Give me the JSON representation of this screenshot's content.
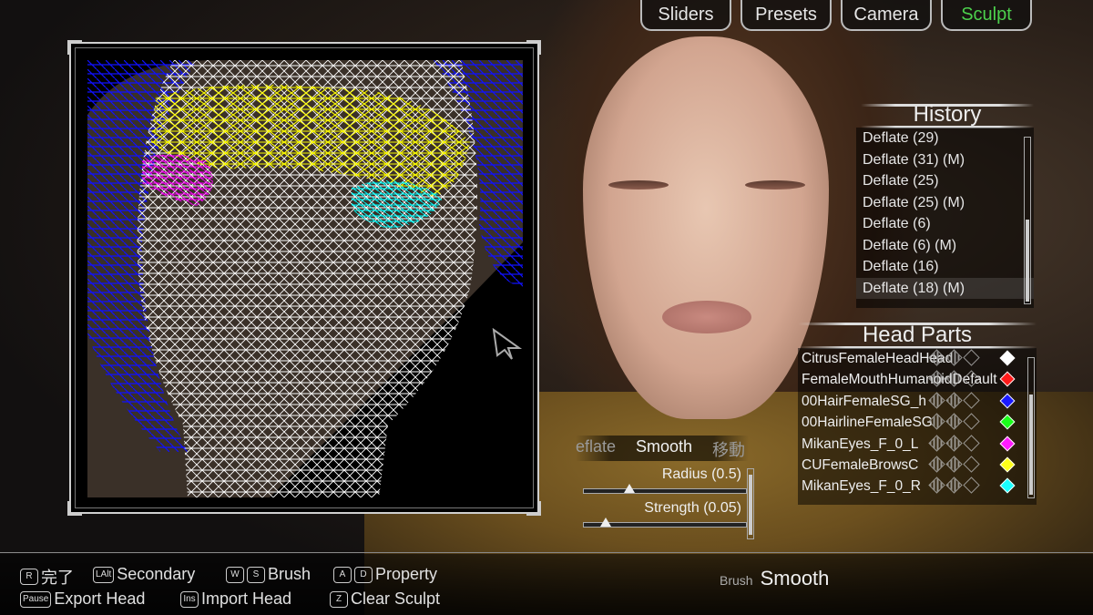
{
  "tabs": [
    {
      "label": "Sliders",
      "active": false
    },
    {
      "label": "Presets",
      "active": false
    },
    {
      "label": "Camera",
      "active": false
    },
    {
      "label": "Sculpt",
      "active": true
    }
  ],
  "history": {
    "title": "History",
    "items": [
      "Deflate (29)",
      "Deflate (31) (M)",
      "Deflate (25)",
      "Deflate (25) (M)",
      "Deflate (6)",
      "Deflate (6) (M)",
      "Deflate (16)",
      "Deflate (18) (M)"
    ],
    "selected_index": 7
  },
  "head_parts": {
    "title": "Head Parts",
    "items": [
      {
        "name": "CitrusFemaleHeadHead",
        "color": "#ffffff"
      },
      {
        "name": "FemaleMouthHumanoidDefault",
        "color": "#ff1a1a"
      },
      {
        "name": "00HairFemaleSG_h",
        "color": "#1a1aff"
      },
      {
        "name": "00HairlineFemaleSG",
        "color": "#1aff1a"
      },
      {
        "name": "MikanEyes_F_0_L",
        "color": "#ff1aff"
      },
      {
        "name": "CUFemaleBrowsC",
        "color": "#ffff1a"
      },
      {
        "name": "MikanEyes_F_0_R",
        "color": "#1affff"
      }
    ]
  },
  "brush_tabs": [
    {
      "label": "eflate",
      "active": false
    },
    {
      "label": "Smooth",
      "active": true
    },
    {
      "label": "移動",
      "active": false
    }
  ],
  "sliders": [
    {
      "label": "Radius (0.5)",
      "value": 0.5
    },
    {
      "label": "Strength (0.05)",
      "value": 0.05
    }
  ],
  "hints": [
    {
      "keys": [
        "R"
      ],
      "label": "完了"
    },
    {
      "keys": [
        "LAlt"
      ],
      "label": "Secondary"
    },
    {
      "keys": [
        "W",
        "S"
      ],
      "label": "Brush"
    },
    {
      "keys": [
        "A",
        "D"
      ],
      "label": "Property"
    },
    {
      "keys": [
        "Pause"
      ],
      "label": "Export Head"
    },
    {
      "keys": [
        "Ins"
      ],
      "label": "Import Head"
    },
    {
      "keys": [
        "Z"
      ],
      "label": "Clear Sculpt"
    }
  ],
  "status": {
    "label": "Brush",
    "value": "Smooth"
  },
  "colors": {
    "active_tab": "#4cd04c",
    "mesh_white": "#ffffff",
    "mesh_yellow": "#ffff00",
    "mesh_blue": "#1010ff",
    "mesh_magenta": "#ff00ff",
    "mesh_cyan": "#00ffff"
  }
}
